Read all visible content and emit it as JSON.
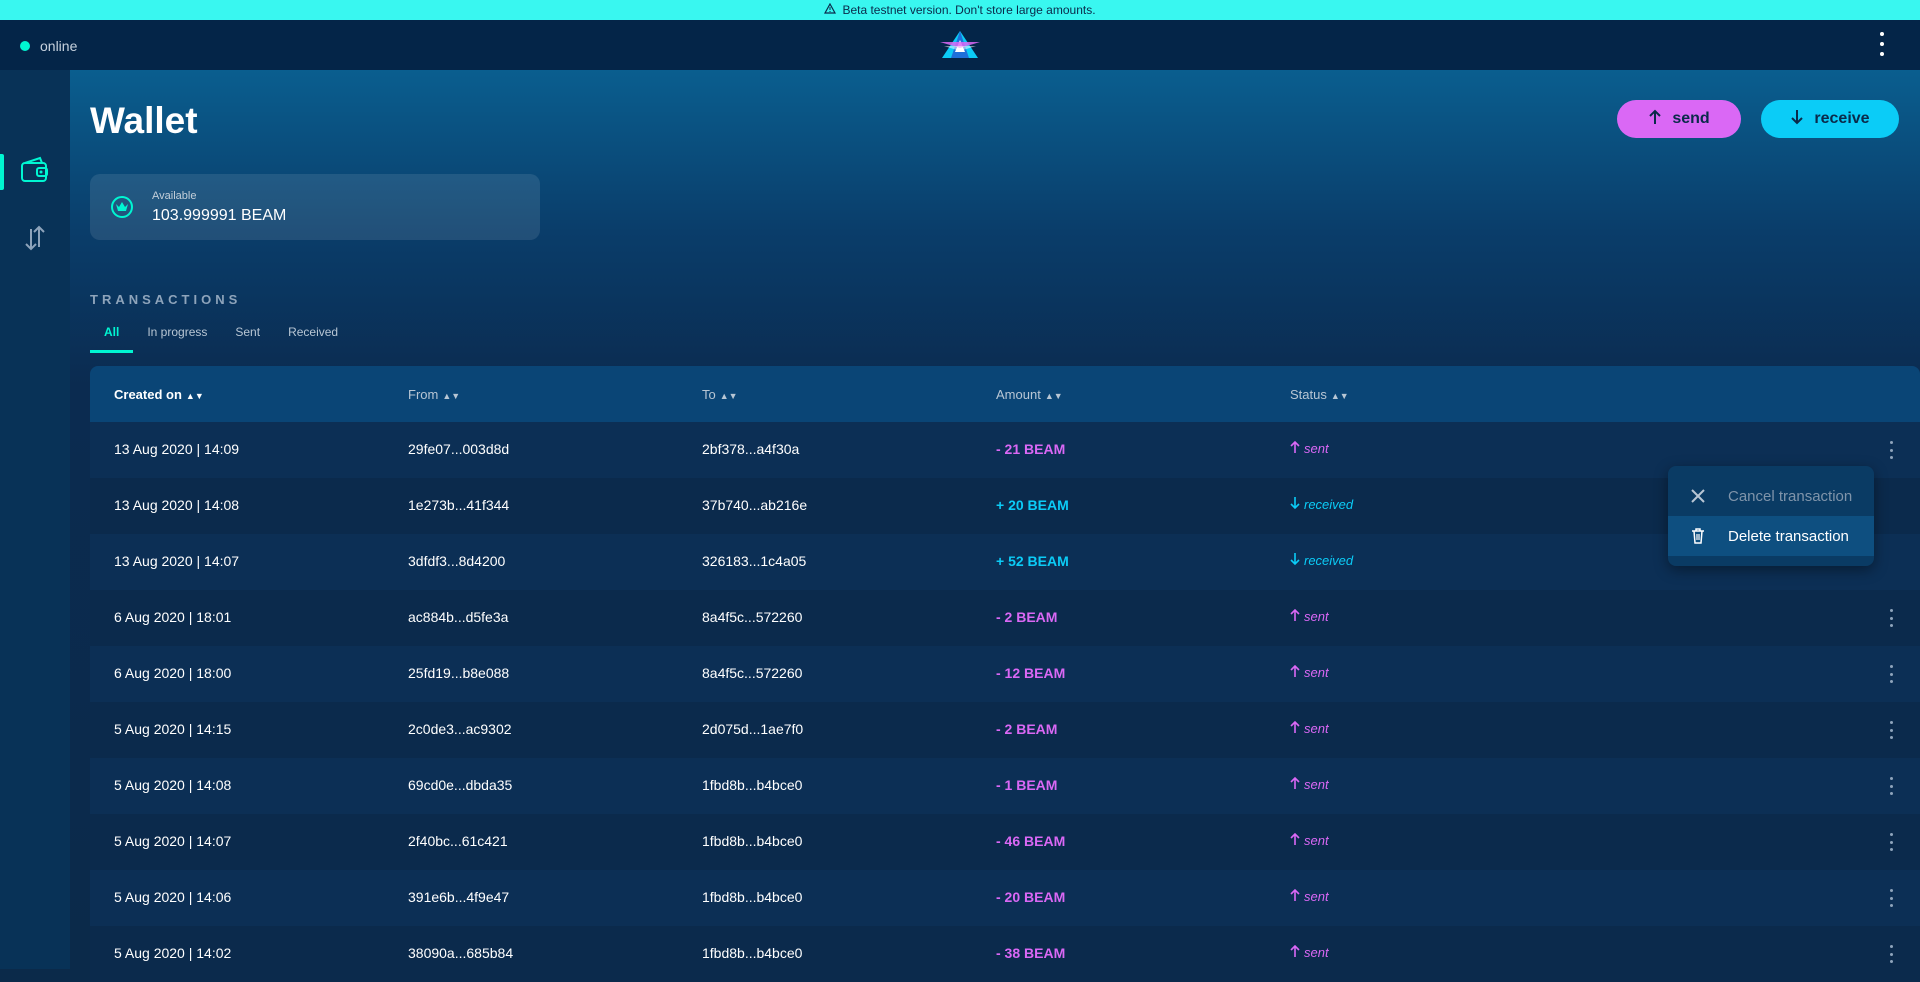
{
  "banner": {
    "text": "Beta testnet version. Don't store large amounts."
  },
  "topbar": {
    "status_label": "online"
  },
  "page": {
    "title": "Wallet"
  },
  "actions": {
    "send_label": "send",
    "receive_label": "receive"
  },
  "balance": {
    "label": "Available",
    "value": "103.999991 BEAM"
  },
  "transactions": {
    "section_title": "TRANSACTIONS",
    "tabs": [
      {
        "label": "All",
        "active": true
      },
      {
        "label": "In progress",
        "active": false
      },
      {
        "label": "Sent",
        "active": false
      },
      {
        "label": "Received",
        "active": false
      }
    ],
    "columns": {
      "created_on": "Created on",
      "from": "From",
      "to": "To",
      "amount": "Amount",
      "status": "Status"
    },
    "rows": [
      {
        "created": "13 Aug 2020 | 14:09",
        "from": "29fe07...003d8d",
        "to": "2bf378...a4f30a",
        "amount": "- 21 BEAM",
        "status": "sent"
      },
      {
        "created": "13 Aug 2020 | 14:08",
        "from": "1e273b...41f344",
        "to": "37b740...ab216e",
        "amount": "+ 20 BEAM",
        "status": "received"
      },
      {
        "created": "13 Aug 2020 | 14:07",
        "from": "3dfdf3...8d4200",
        "to": "326183...1c4a05",
        "amount": "+ 52 BEAM",
        "status": "received"
      },
      {
        "created": "6 Aug 2020 | 18:01",
        "from": "ac884b...d5fe3a",
        "to": "8a4f5c...572260",
        "amount": "- 2 BEAM",
        "status": "sent"
      },
      {
        "created": "6 Aug 2020 | 18:00",
        "from": "25fd19...b8e088",
        "to": "8a4f5c...572260",
        "amount": "- 12 BEAM",
        "status": "sent"
      },
      {
        "created": "5 Aug 2020 | 14:15",
        "from": "2c0de3...ac9302",
        "to": "2d075d...1ae7f0",
        "amount": "- 2 BEAM",
        "status": "sent"
      },
      {
        "created": "5 Aug 2020 | 14:08",
        "from": "69cd0e...dbda35",
        "to": "1fbd8b...b4bce0",
        "amount": "- 1 BEAM",
        "status": "sent"
      },
      {
        "created": "5 Aug 2020 | 14:07",
        "from": "2f40bc...61c421",
        "to": "1fbd8b...b4bce0",
        "amount": "- 46 BEAM",
        "status": "sent"
      },
      {
        "created": "5 Aug 2020 | 14:06",
        "from": "391e6b...4f9e47",
        "to": "1fbd8b...b4bce0",
        "amount": "- 20 BEAM",
        "status": "sent"
      },
      {
        "created": "5 Aug 2020 | 14:02",
        "from": "38090a...685b84",
        "to": "1fbd8b...b4bce0",
        "amount": "- 38 BEAM",
        "status": "sent"
      }
    ]
  },
  "context_menu": {
    "cancel_label": "Cancel transaction",
    "delete_label": "Delete transaction"
  },
  "colors": {
    "accent": "#00f6d2",
    "send": "#da68f5",
    "receive": "#0bccf7",
    "banner": "#39f7f0"
  }
}
